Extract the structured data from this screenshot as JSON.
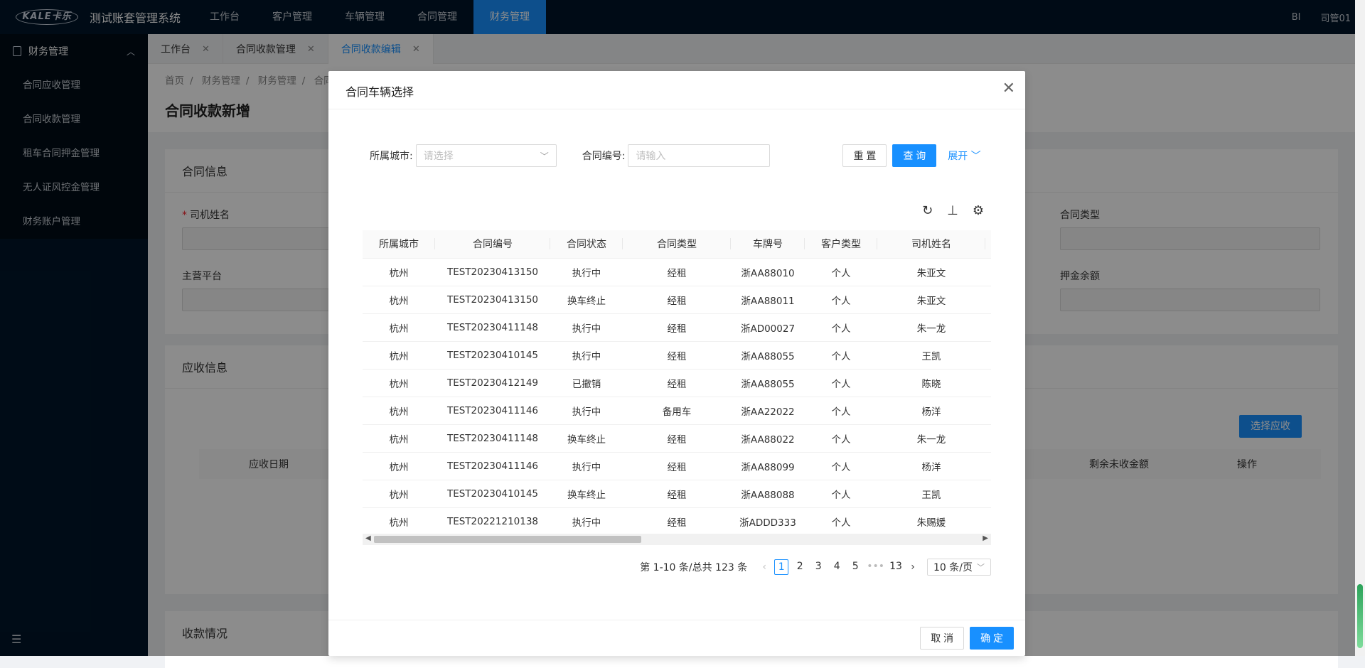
{
  "app": {
    "logo_text": "KALE卡乐",
    "title": "测试账套管理系统"
  },
  "topnav": [
    "工作台",
    "客户管理",
    "车辆管理",
    "合同管理",
    "财务管理"
  ],
  "topnav_active": 4,
  "top_right": {
    "bi": "BI",
    "user": "司管01"
  },
  "sidebar": {
    "header": "财务管理",
    "items": [
      "合同应收管理",
      "合同收款管理",
      "租车合同押金管理",
      "无人证风控金管理",
      "财务账户管理"
    ]
  },
  "tabs": [
    {
      "label": "工作台"
    },
    {
      "label": "合同收款管理"
    },
    {
      "label": "合同收款编辑",
      "active": true
    }
  ],
  "breadcrumb": [
    "首页",
    "财务管理",
    "财务管理",
    "合同"
  ],
  "page_title": "合同收款新增",
  "background_form": {
    "section1_title": "合同信息",
    "driver_label": "司机姓名",
    "contract_type_label": "合同类型",
    "platform_label": "主营平台",
    "deposit_label": "押金余额",
    "section2_title": "应收信息",
    "select_receivable_btn": "选择应收",
    "cols": {
      "date": "应收日期",
      "remaining": "剩余未收金额",
      "op": "操作"
    },
    "section3_title": "收款情况"
  },
  "modal": {
    "title": "合同车辆选择",
    "filters": {
      "city_label": "所属城市:",
      "city_placeholder": "请选择",
      "contract_label": "合同编号:",
      "contract_placeholder": "请输入",
      "reset": "重 置",
      "query": "查 询",
      "expand": "展开"
    },
    "columns": [
      "所属城市",
      "合同编号",
      "合同状态",
      "合同类型",
      "车牌号",
      "客户类型",
      "司机姓名"
    ],
    "rows": [
      [
        "杭州",
        "TEST20230413150",
        "执行中",
        "经租",
        "浙AA88010",
        "个人",
        "朱亚文"
      ],
      [
        "杭州",
        "TEST20230413150",
        "换车终止",
        "经租",
        "浙AA88011",
        "个人",
        "朱亚文"
      ],
      [
        "杭州",
        "TEST20230411148",
        "执行中",
        "经租",
        "浙AD00027",
        "个人",
        "朱一龙"
      ],
      [
        "杭州",
        "TEST20230410145",
        "执行中",
        "经租",
        "浙AA88055",
        "个人",
        "王凯"
      ],
      [
        "杭州",
        "TEST20230412149",
        "已撤销",
        "经租",
        "浙AA88055",
        "个人",
        "陈晓"
      ],
      [
        "杭州",
        "TEST20230411146",
        "执行中",
        "备用车",
        "浙AA22022",
        "个人",
        "杨洋"
      ],
      [
        "杭州",
        "TEST20230411148",
        "换车终止",
        "经租",
        "浙AA88022",
        "个人",
        "朱一龙"
      ],
      [
        "杭州",
        "TEST20230411146",
        "执行中",
        "经租",
        "浙AA88099",
        "个人",
        "杨洋"
      ],
      [
        "杭州",
        "TEST20230410145",
        "换车终止",
        "经租",
        "浙AA88088",
        "个人",
        "王凯"
      ],
      [
        "杭州",
        "TEST20221210138",
        "执行中",
        "经租",
        "浙ADDD333",
        "个人",
        "朱赐媛"
      ]
    ],
    "pagination": {
      "total_text": "第 1-10 条/总共 123 条",
      "pages": [
        "1",
        "2",
        "3",
        "4",
        "5",
        "•••",
        "13"
      ],
      "current": "1",
      "page_size": "10 条/页"
    },
    "footer": {
      "cancel": "取 消",
      "ok": "确 定"
    }
  }
}
